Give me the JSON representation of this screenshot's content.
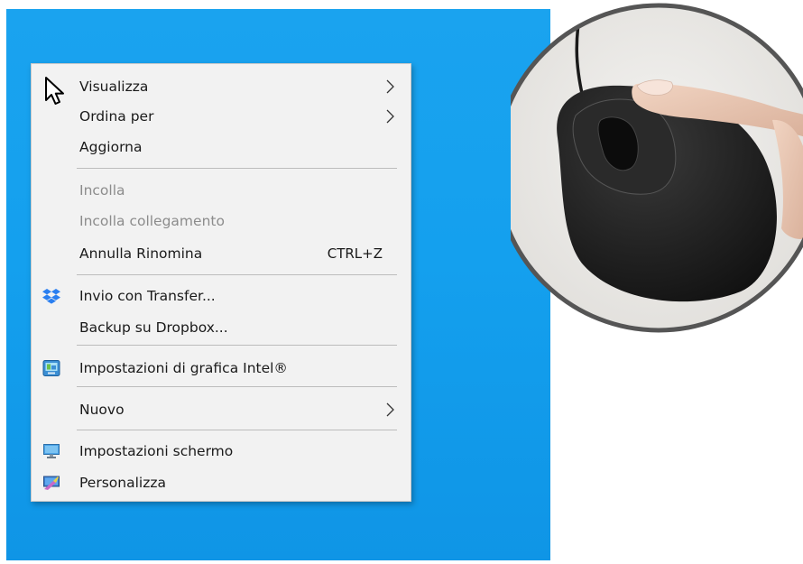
{
  "context_menu": {
    "items": [
      {
        "label": "Visualizza",
        "submenu": true,
        "disabled": false
      },
      {
        "label": "Ordina per",
        "submenu": true,
        "disabled": false
      },
      {
        "label": "Aggiorna",
        "submenu": false,
        "disabled": false
      },
      {
        "label": "Incolla",
        "submenu": false,
        "disabled": true
      },
      {
        "label": "Incolla collegamento",
        "submenu": false,
        "disabled": true
      },
      {
        "label": "Annulla Rinomina",
        "shortcut": "CTRL+Z",
        "submenu": false,
        "disabled": false
      },
      {
        "label": "Invio con Transfer...",
        "icon": "dropbox-icon",
        "submenu": false,
        "disabled": false
      },
      {
        "label": "Backup su Dropbox...",
        "submenu": false,
        "disabled": false
      },
      {
        "label": "Impostazioni di grafica Intel®",
        "icon": "intel-graphics-icon",
        "submenu": false,
        "disabled": false
      },
      {
        "label": "Nuovo",
        "submenu": true,
        "disabled": false
      },
      {
        "label": "Impostazioni schermo",
        "icon": "display-settings-icon",
        "submenu": false,
        "disabled": false
      },
      {
        "label": "Personalizza",
        "icon": "personalize-icon",
        "submenu": false,
        "disabled": false
      }
    ]
  },
  "colors": {
    "desktop_background": "#14a0ee",
    "menu_background": "#f2f2f2",
    "disabled_text": "#8c8c8c",
    "photo_border": "#555555"
  },
  "photo": {
    "subject": "mouse-right-click-photo"
  }
}
